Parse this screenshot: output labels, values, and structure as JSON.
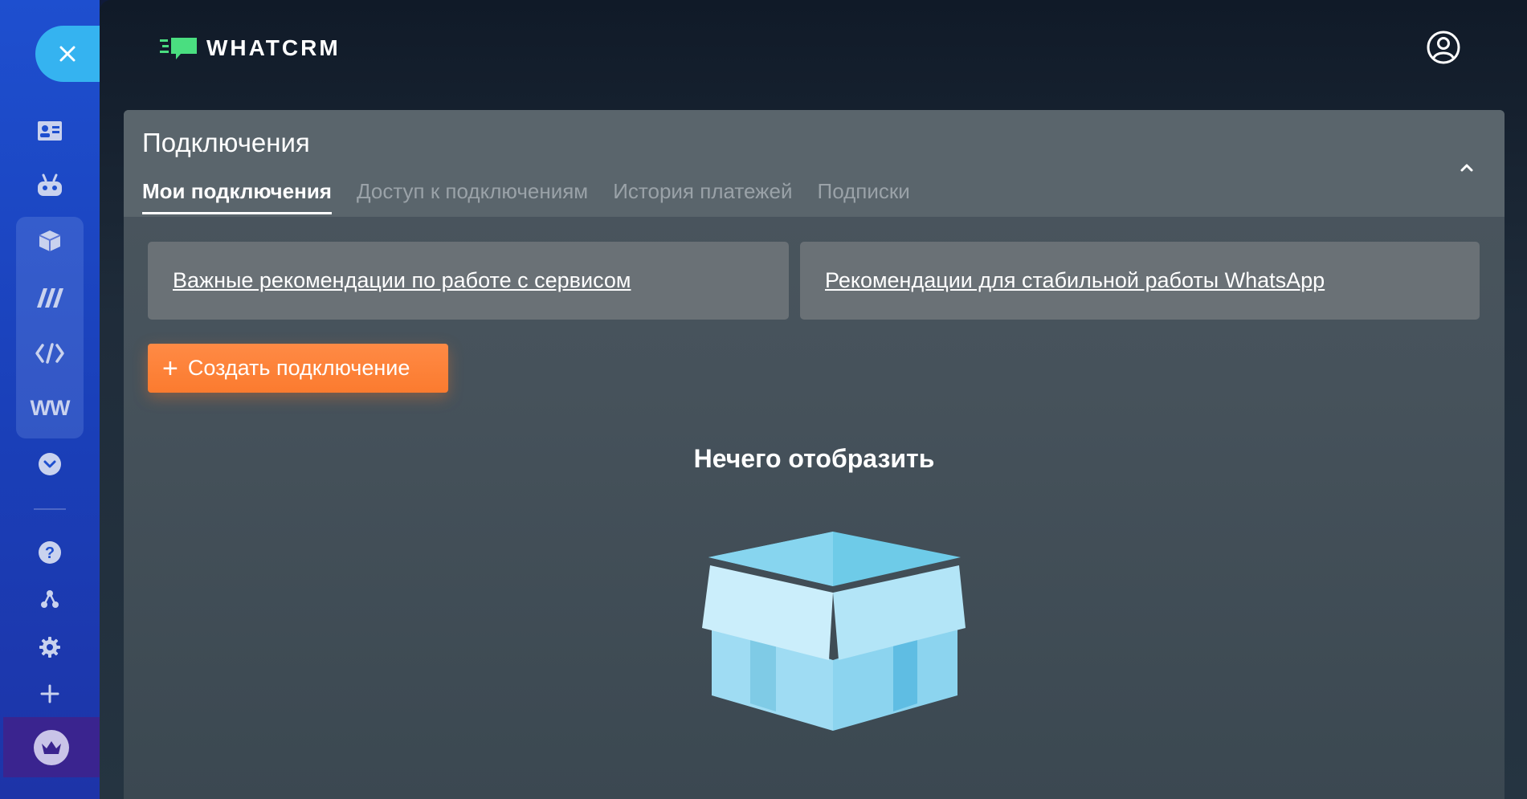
{
  "colors": {
    "sidebar": "#1e4fcf",
    "close_button": "#35b3f0",
    "logo_green": "#4ade80",
    "accent_orange": "#fb7b2f",
    "box_blue": "#8fd6f1"
  },
  "sidebar": {
    "items": [
      {
        "icon": "contact-card-icon"
      },
      {
        "icon": "robot-icon"
      },
      {
        "icon": "cube-icon"
      },
      {
        "icon": "m-logo-icon"
      },
      {
        "icon": "code-icon"
      },
      {
        "icon": "ww-logo-icon",
        "label": "WW"
      },
      {
        "icon": "chevron-down-circle-icon"
      },
      {
        "icon": "help-icon"
      },
      {
        "icon": "nodes-icon"
      },
      {
        "icon": "gear-icon"
      },
      {
        "icon": "plus-icon"
      },
      {
        "icon": "crown-icon"
      }
    ]
  },
  "header": {
    "logo_text": "WHATCRM",
    "profile_icon": "user-circle-icon"
  },
  "panel": {
    "title": "Подключения",
    "tabs": [
      {
        "label": "Мои подключения",
        "active": true
      },
      {
        "label": "Доступ к подключениям",
        "active": false
      },
      {
        "label": "История платежей",
        "active": false
      },
      {
        "label": "Подписки",
        "active": false
      }
    ],
    "recommendations": [
      {
        "label": "Важные рекомендации по работе с сервисом"
      },
      {
        "label": "Рекомендации для стабильной работы WhatsApp"
      }
    ],
    "create_button": "Создать подключение",
    "empty_text": "Нечего отобразить"
  }
}
